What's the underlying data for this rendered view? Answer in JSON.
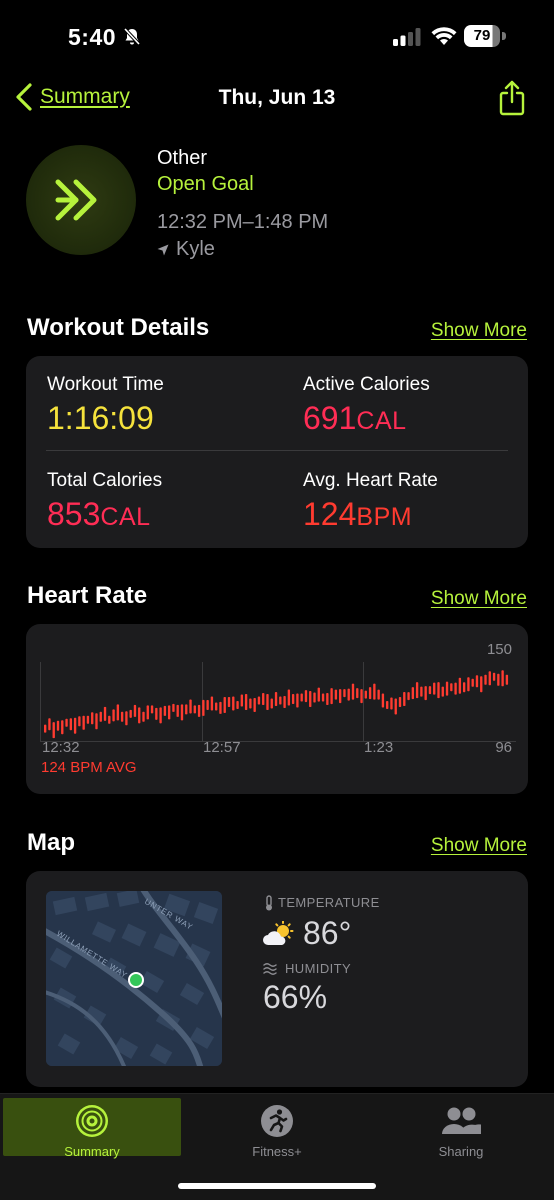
{
  "status_bar": {
    "time": "5:40",
    "battery": "79",
    "battery_level": 0.79
  },
  "nav": {
    "back_label": "Summary",
    "title": "Thu, Jun 13"
  },
  "workout": {
    "type": "Other",
    "goal": "Open Goal",
    "time_range": "12:32 PM–1:48 PM",
    "location": "Kyle",
    "accent_color": "#b6f23c"
  },
  "details": {
    "title": "Workout Details",
    "show_more": "Show More",
    "workout_time_label": "Workout Time",
    "workout_time_value": "1:16:09",
    "active_calories_label": "Active Calories",
    "active_calories_value": "691",
    "active_calories_unit": "CAL",
    "total_calories_label": "Total Calories",
    "total_calories_value": "853",
    "total_calories_unit": "CAL",
    "avg_hr_label": "Avg. Heart Rate",
    "avg_hr_value": "124",
    "avg_hr_unit": "BPM",
    "colors": {
      "time": "#f5e23c",
      "calories": "#ff2d55",
      "heart": "#ff3b30"
    }
  },
  "heart_rate": {
    "title": "Heart Rate",
    "show_more": "Show More",
    "y_max_label": "150",
    "y_min_label": "96",
    "x_labels": [
      "12:32",
      "12:57",
      "1:23"
    ],
    "avg_label": "124 BPM AVG",
    "chart_data": {
      "type": "bar",
      "ylim": [
        96,
        150
      ],
      "values": [
        105,
        108,
        104,
        107,
        106,
        109,
        108,
        107,
        110,
        109,
        111,
        112,
        110,
        113,
        115,
        111,
        114,
        116,
        113,
        112,
        115,
        117,
        114,
        113,
        116,
        118,
        115,
        114,
        117,
        116,
        119,
        117,
        116,
        118,
        120,
        118,
        117,
        119,
        121,
        122,
        120,
        119,
        121,
        123,
        122,
        121,
        124,
        123,
        122,
        121,
        124,
        125,
        123,
        122,
        125,
        124,
        123,
        126,
        125,
        124,
        126,
        127,
        125,
        126,
        128,
        126,
        125,
        127,
        128,
        127,
        129,
        128,
        130,
        129,
        127,
        128,
        129,
        130,
        128,
        124,
        121,
        122,
        120,
        123,
        125,
        127,
        129,
        131,
        130,
        129,
        131,
        132,
        131,
        130,
        132,
        133,
        132,
        134,
        133,
        135,
        136,
        137,
        135,
        138,
        139,
        140,
        138,
        139,
        138
      ]
    }
  },
  "map": {
    "title": "Map",
    "show_more": "Show More",
    "street_1": "WILLAMETTE WAY",
    "street_2": "UNTER WAY",
    "temperature_label": "TEMPERATURE",
    "temperature_value": "86°",
    "humidity_label": "HUMIDITY",
    "humidity_value": "66%"
  },
  "tabs": [
    {
      "label": "Summary",
      "icon": "activity-rings-icon",
      "active": true
    },
    {
      "label": "Fitness+",
      "icon": "runner-icon",
      "active": false
    },
    {
      "label": "Sharing",
      "icon": "people-icon",
      "active": false
    }
  ]
}
